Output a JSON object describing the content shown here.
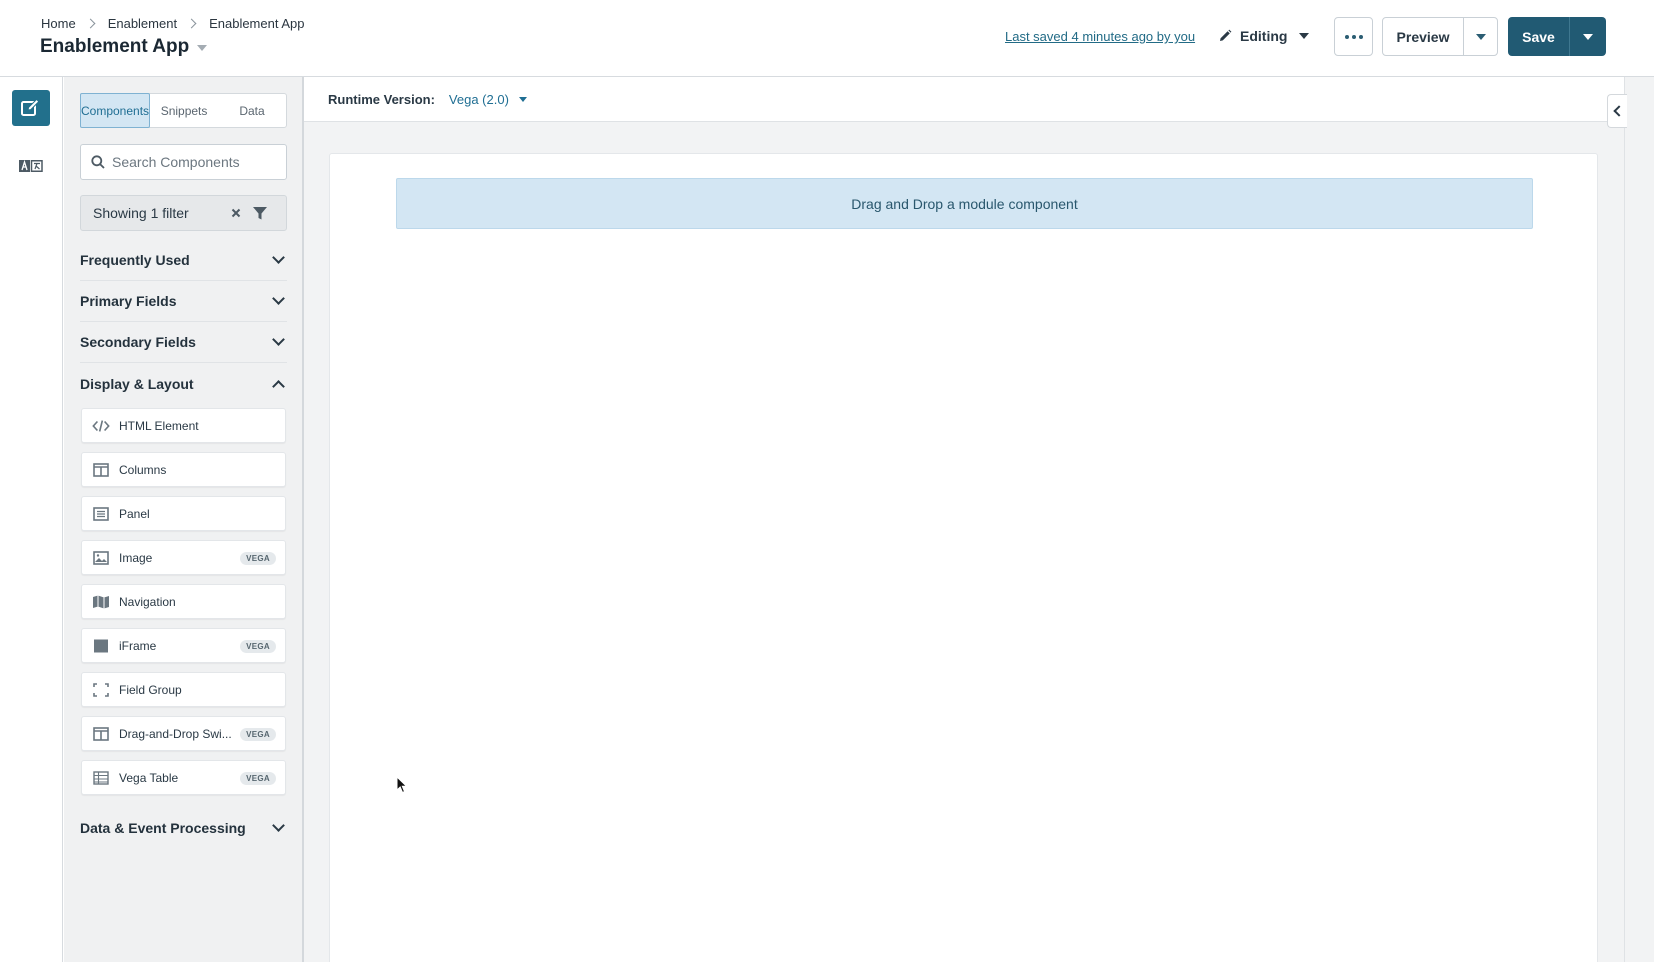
{
  "header": {
    "breadcrumb": [
      "Home",
      "Enablement",
      "Enablement App"
    ],
    "title": "Enablement App",
    "last_saved": "Last saved 4 minutes ago by you",
    "mode": "Editing",
    "preview_label": "Preview",
    "save_label": "Save"
  },
  "left_rail": {
    "icons": [
      "edit-icon",
      "translate-icon"
    ],
    "accent_color": "#22708c"
  },
  "panel": {
    "tabs": [
      {
        "label": "Components",
        "active": true
      },
      {
        "label": "Snippets",
        "active": false
      },
      {
        "label": "Data",
        "active": false
      }
    ],
    "search_placeholder": "Search Components",
    "filter_text": "Showing 1 filter",
    "sections": [
      {
        "label": "Frequently Used",
        "expanded": false
      },
      {
        "label": "Primary Fields",
        "expanded": false
      },
      {
        "label": "Secondary Fields",
        "expanded": false
      },
      {
        "label": "Display & Layout",
        "expanded": true
      },
      {
        "label": "Data & Event Processing",
        "expanded": false
      }
    ],
    "display_layout_items": [
      {
        "label": "HTML Element",
        "icon": "code-icon",
        "badge": ""
      },
      {
        "label": "Columns",
        "icon": "columns-icon",
        "badge": ""
      },
      {
        "label": "Panel",
        "icon": "panel-icon",
        "badge": ""
      },
      {
        "label": "Image",
        "icon": "image-icon",
        "badge": "VEGA"
      },
      {
        "label": "Navigation",
        "icon": "map-icon",
        "badge": ""
      },
      {
        "label": "iFrame",
        "icon": "iframe-icon",
        "badge": "VEGA"
      },
      {
        "label": "Field Group",
        "icon": "field-group-icon",
        "badge": ""
      },
      {
        "label": "Drag-and-Drop Swi...",
        "icon": "columns-icon",
        "badge": "VEGA"
      },
      {
        "label": "Vega Table",
        "icon": "table-icon",
        "badge": "VEGA"
      }
    ]
  },
  "canvas": {
    "runtime_label": "Runtime Version:",
    "runtime_value": "Vega (2.0)",
    "dropzone_text": "Drag and Drop a module component"
  },
  "colors": {
    "primary": "#215a73",
    "link": "#226b86",
    "dropzone_bg": "#d3e6f3"
  }
}
